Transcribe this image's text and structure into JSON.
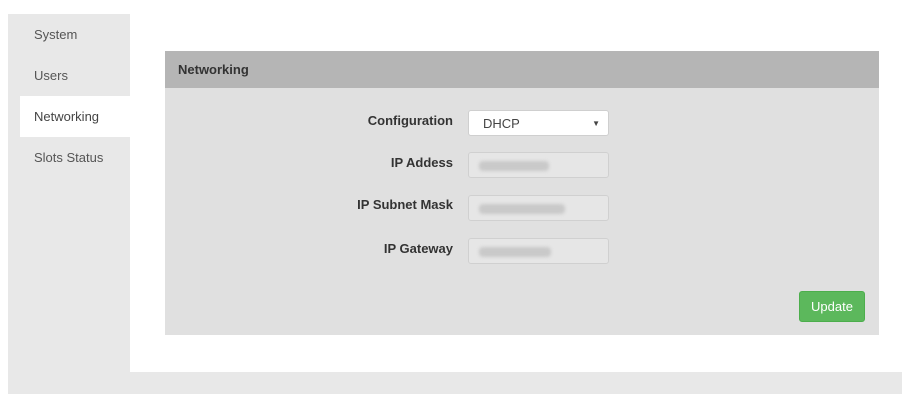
{
  "sidebar": {
    "items": [
      {
        "label": "System"
      },
      {
        "label": "Users"
      },
      {
        "label": "Networking"
      },
      {
        "label": "Slots Status"
      }
    ]
  },
  "panel": {
    "title": "Networking",
    "fields": {
      "configuration": {
        "label": "Configuration",
        "value": "DHCP"
      },
      "ip_address": {
        "label": "IP Addess"
      },
      "subnet_mask": {
        "label": "IP Subnet Mask"
      },
      "gateway": {
        "label": "IP Gateway"
      }
    },
    "update_label": "Update"
  },
  "colors": {
    "accent_green": "#5cb85c",
    "panel_header": "#b5b5b5",
    "sidebar_bg": "#e8e8e8"
  }
}
